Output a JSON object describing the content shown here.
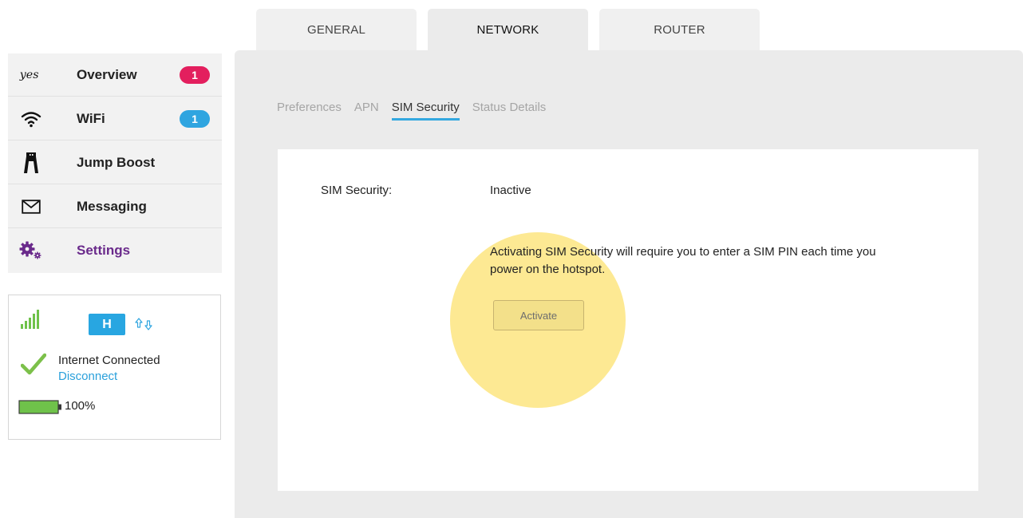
{
  "top_tabs": [
    {
      "label": "GENERAL",
      "active": false
    },
    {
      "label": "NETWORK",
      "active": true
    },
    {
      "label": "ROUTER",
      "active": false
    }
  ],
  "sidebar": {
    "logo_text": "yes",
    "items": [
      {
        "label": "Overview",
        "icon": "yes-logo-icon",
        "badge": "1",
        "badge_color": "#e31f5e"
      },
      {
        "label": "WiFi",
        "icon": "wifi-icon",
        "badge": "1",
        "badge_color": "#2fa5e0"
      },
      {
        "label": "Jump Boost",
        "icon": "jump-boost-icon"
      },
      {
        "label": "Messaging",
        "icon": "envelope-icon"
      },
      {
        "label": "Settings",
        "icon": "gear-icon",
        "active": true
      }
    ]
  },
  "status": {
    "network_type": "H",
    "connection_text": "Internet Connected",
    "disconnect_label": "Disconnect",
    "battery_percent": "100%",
    "signal_icon": "signal-bars-icon",
    "transfer_icon": "up-down-arrows-icon",
    "connected_icon": "checkmark-icon",
    "battery_icon": "battery-icon"
  },
  "sub_tabs": [
    {
      "label": "Preferences",
      "active": false
    },
    {
      "label": "APN",
      "active": false
    },
    {
      "label": "SIM Security",
      "active": true
    },
    {
      "label": "Status Details",
      "active": false
    }
  ],
  "sim_security": {
    "label": "SIM Security:",
    "value": "Inactive",
    "description": "Activating SIM Security will require you to enter a SIM PIN each time you power on the hotspot.",
    "activate_label": "Activate"
  },
  "colors": {
    "accent_blue": "#2fa5e0",
    "accent_red": "#e31f5e",
    "active_purple": "#6a2a8b",
    "highlight_yellow": "#fcdc50"
  }
}
